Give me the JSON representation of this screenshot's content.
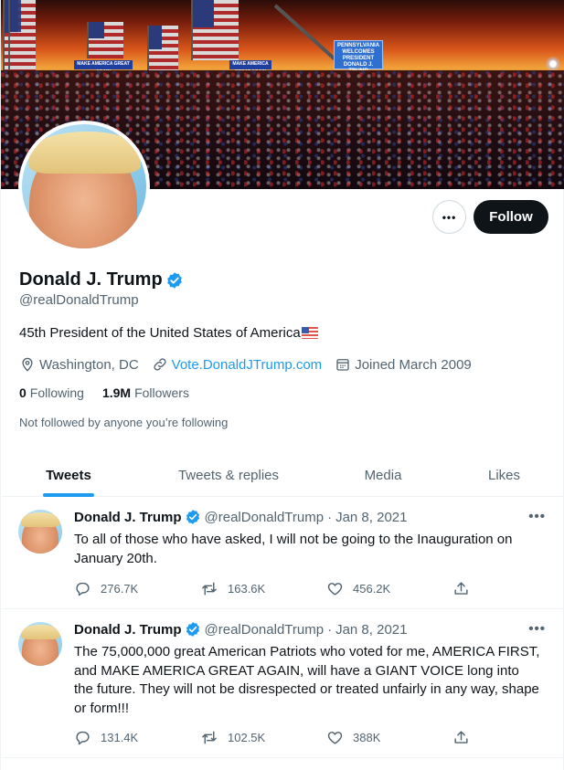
{
  "profile": {
    "display_name": "Donald J. Trump",
    "handle": "@realDonaldTrump",
    "bio": "45th President of the United States of America",
    "location": "Washington, DC",
    "website": "Vote.DonaldJTrump.com",
    "joined": "Joined March 2009",
    "following_count": "0",
    "following_label": "Following",
    "followers_count": "1.9M",
    "followers_label": "Followers",
    "not_followed_text": "Not followed by anyone you’re following",
    "follow_button": "Follow",
    "more_button": "•••"
  },
  "banner": {
    "sign_left": "MAKE AMERICA GREAT AGAIN",
    "sign_right": "MAKE AMERICA GREAT AGAIN",
    "sign_center": "PENNSYLVANIA WELCOMES PRESIDENT DONALD J. TRUMP"
  },
  "tabs": [
    {
      "label": "Tweets",
      "active": true
    },
    {
      "label": "Tweets & replies",
      "active": false
    },
    {
      "label": "Media",
      "active": false
    },
    {
      "label": "Likes",
      "active": false
    }
  ],
  "tweets": [
    {
      "name": "Donald J. Trump",
      "handle": "@realDonaldTrump",
      "separator": "·",
      "date": "Jan 8, 2021",
      "text": "To all of those who have asked, I will not be going to the Inauguration on January 20th.",
      "replies": "276.7K",
      "retweets": "163.6K",
      "likes": "456.2K"
    },
    {
      "name": "Donald J. Trump",
      "handle": "@realDonaldTrump",
      "separator": "·",
      "date": "Jan 8, 2021",
      "text": "The 75,000,000 great American Patriots who voted for me, AMERICA FIRST, and MAKE AMERICA GREAT AGAIN, will have a GIANT VOICE long into the future. They will not be disrespected or treated unfairly in any way, shape or form!!!",
      "replies": "131.4K",
      "retweets": "102.5K",
      "likes": "388K"
    }
  ],
  "colors": {
    "accent": "#1d9bf0",
    "text_primary": "#0f1419",
    "text_secondary": "#536471",
    "follow_button_bg": "#0f1419"
  },
  "icons": {
    "verified": "verified-badge-icon",
    "location": "location-pin-icon",
    "link": "link-icon",
    "calendar": "calendar-icon",
    "reply": "reply-icon",
    "retweet": "retweet-icon",
    "like": "heart-icon",
    "share": "share-icon",
    "more": "more-icon"
  }
}
